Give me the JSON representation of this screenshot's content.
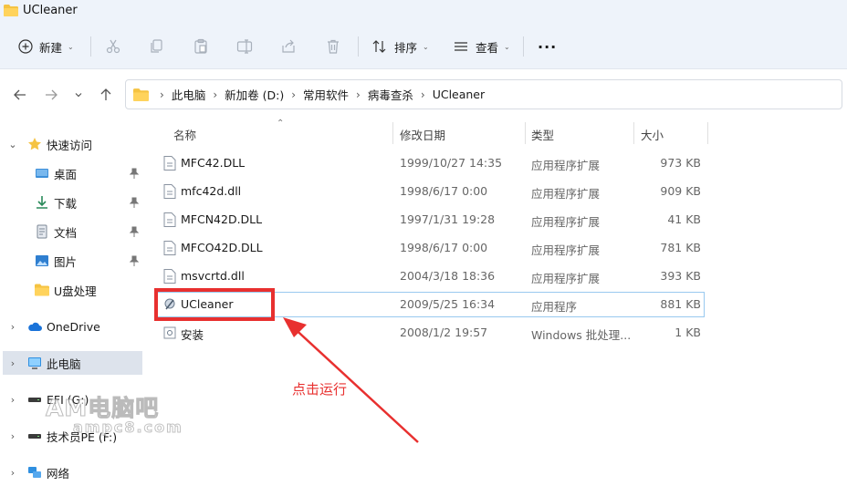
{
  "window": {
    "title": "UCleaner"
  },
  "toolbar": {
    "new_label": "新建",
    "sort_label": "排序",
    "view_label": "查看",
    "more_label": "···"
  },
  "breadcrumb": [
    "此电脑",
    "新加卷 (D:)",
    "常用软件",
    "病毒查杀",
    "UCleaner"
  ],
  "nav": {
    "quick_access": "快速访问",
    "desktop": "桌面",
    "downloads": "下载",
    "documents": "文档",
    "pictures": "图片",
    "u_disk": "U盘处理",
    "onedrive": "OneDrive",
    "this_pc": "此电脑",
    "efi": "EFI (G:)",
    "techpe": "技术员PE (F:)",
    "network": "网络"
  },
  "columns": {
    "name": "名称",
    "date": "修改日期",
    "type": "类型",
    "size": "大小"
  },
  "files": [
    {
      "name": "MFC42.DLL",
      "date": "1999/10/27 14:35",
      "type": "应用程序扩展",
      "size": "973 KB"
    },
    {
      "name": "mfc42d.dll",
      "date": "1998/6/17 0:00",
      "type": "应用程序扩展",
      "size": "909 KB"
    },
    {
      "name": "MFCN42D.DLL",
      "date": "1997/1/31 19:28",
      "type": "应用程序扩展",
      "size": "41 KB"
    },
    {
      "name": "MFCO42D.DLL",
      "date": "1998/6/17 0:00",
      "type": "应用程序扩展",
      "size": "781 KB"
    },
    {
      "name": "msvcrtd.dll",
      "date": "2004/3/18 18:36",
      "type": "应用程序扩展",
      "size": "393 KB"
    },
    {
      "name": "UCleaner",
      "date": "2009/5/25 16:34",
      "type": "应用程序",
      "size": "881 KB"
    },
    {
      "name": "安装",
      "date": "2008/1/2 19:57",
      "type": "Windows 批处理...",
      "size": "1 KB"
    }
  ],
  "annotation": {
    "text": "点击运行"
  },
  "watermark": {
    "main": "AM电脑吧",
    "sub": "ampc8.com"
  },
  "colors": {
    "accent_red": "#e8302f",
    "selection_border": "#99c9ef",
    "folder_yellow": "#f5c342",
    "toolbar_bg": "#eef3fa"
  }
}
